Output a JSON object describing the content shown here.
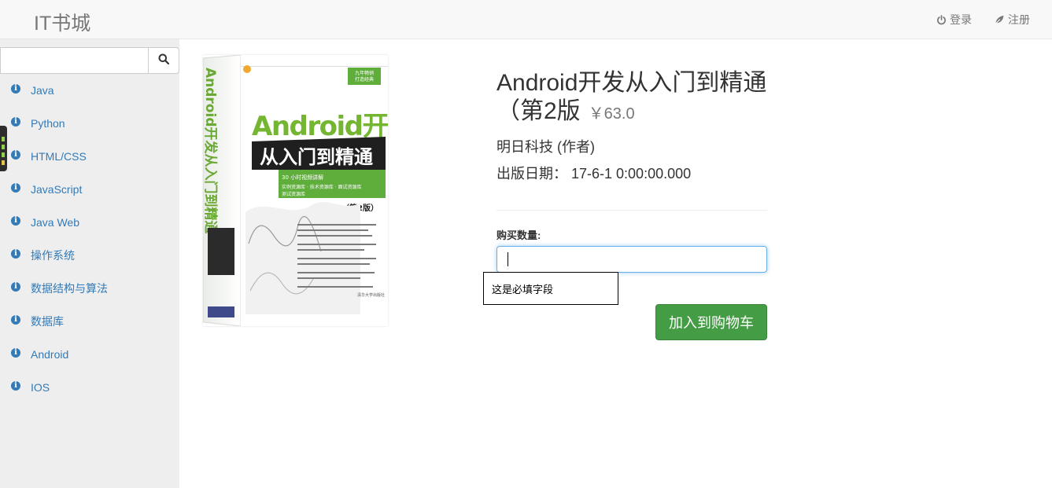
{
  "navbar": {
    "brand": "IT书城",
    "login_label": "登录",
    "register_label": "注册"
  },
  "sidebar": {
    "search": {
      "value": "",
      "placeholder": ""
    },
    "categories": [
      {
        "label": "Java"
      },
      {
        "label": "Python"
      },
      {
        "label": "HTML/CSS"
      },
      {
        "label": "JavaScript"
      },
      {
        "label": "Java Web"
      },
      {
        "label": "操作系统"
      },
      {
        "label": "数据结构与算法"
      },
      {
        "label": "数据库"
      },
      {
        "label": "Android"
      },
      {
        "label": "IOS"
      }
    ]
  },
  "book": {
    "title": "Android开发从入门到精通（第2版",
    "price": "￥63.0",
    "author": "明日科技 (作者)",
    "pubdate": "出版日期：  17-6-1 0:00:00.000",
    "cover": {
      "series_badge": "九年畅销\n打造经典",
      "title_line1": "Android开发",
      "title_line2": "从入门到精通",
      "edition": "（第2版）",
      "features": [
        "30 小时视频讲解",
        "实例资源库",
        "技术资源库",
        "面试资源库",
        "测试资源库"
      ],
      "spine_text": "Android开发从入门到精通",
      "publisher": "清华大学出版社"
    }
  },
  "purchase": {
    "quantity_label": "购买数量:",
    "quantity_value": "",
    "validation_message": "这是必填字段",
    "add_to_cart_label": "加入到购物车"
  },
  "colors": {
    "link": "#337ab7",
    "success": "#449d44",
    "navbar_bg": "#f8f8f8",
    "sidebar_bg": "#eeeeee"
  }
}
